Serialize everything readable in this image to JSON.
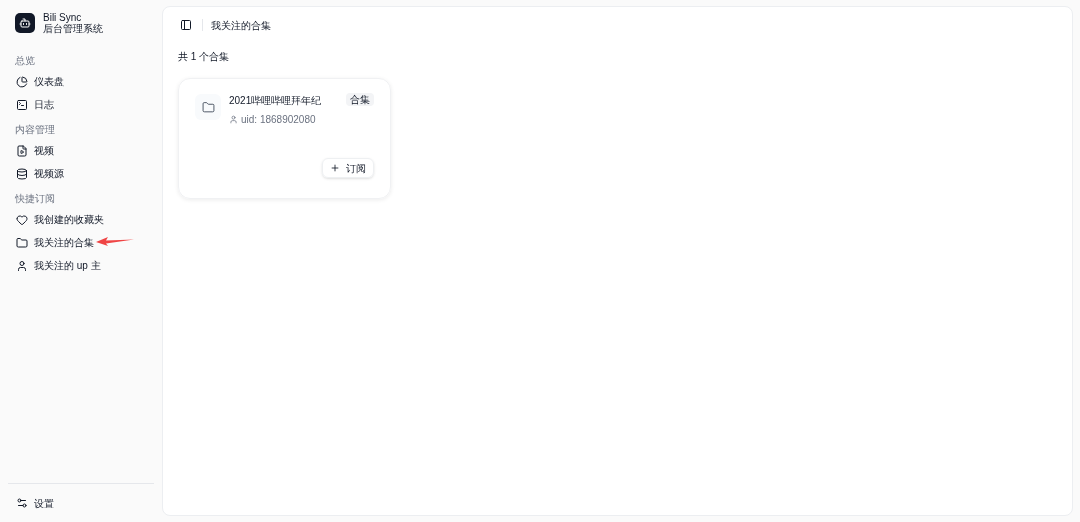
{
  "brand": {
    "name": "Bili Sync",
    "subtitle": "后台管理系统"
  },
  "sidebar": {
    "groups": [
      {
        "label": "总览",
        "items": [
          {
            "label": "仪表盘",
            "selected": false
          },
          {
            "label": "日志",
            "selected": false
          }
        ]
      },
      {
        "label": "内容管理",
        "items": [
          {
            "label": "视频",
            "selected": false
          },
          {
            "label": "视频源",
            "selected": false
          }
        ]
      },
      {
        "label": "快捷订阅",
        "items": [
          {
            "label": "我创建的收藏夹",
            "selected": false
          },
          {
            "label": "我关注的合集",
            "selected": false,
            "annotated": true
          },
          {
            "label": "我关注的 up 主",
            "selected": false
          }
        ]
      }
    ],
    "footer": {
      "label": "设置"
    }
  },
  "breadcrumb": "我关注的合集",
  "count_text": "共 1 个合集",
  "cards": [
    {
      "title": "2021哔哩哔哩拜年纪",
      "badge": "合集",
      "uid": "uid: 1868902080",
      "action": "订阅"
    }
  ]
}
